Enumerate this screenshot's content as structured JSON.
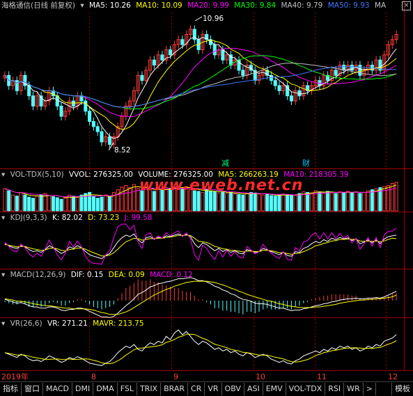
{
  "main_header": {
    "stock_name": "海格通信(日线 前复权)",
    "ma5_label": "MA5: 10.26",
    "ma10_label": "MA10: 10.09",
    "ma20_label": "MA20: 9.99",
    "ma30_label": "MA30: 9.84",
    "ma40_label": "MA40: 9.79",
    "ma50_label": "MA50: 9.93",
    "ma_more_label": "MA",
    "close_label": "×"
  },
  "price_annotations": {
    "high": "10.96",
    "low": "8.52"
  },
  "event_markers": {
    "reduce": "减",
    "fund": "财"
  },
  "vol_header": {
    "name": "VOL-TDX(5,10)",
    "vvol": "VVOL: 276325.00",
    "volume": "VOLUME: 276325.00",
    "ma5": "MA5: 266263.19",
    "ma10": "MA10: 218305.39"
  },
  "watermark": "www.eweb.net.cn",
  "kdj_header": {
    "name": "KDJ(9,3,3)",
    "k": "K: 82.02",
    "d": "D: 73.23",
    "j": "J: 99.58"
  },
  "macd_header": {
    "name": "MACD(12,26,9)",
    "dif": "DIF: 0.15",
    "dea": "DEA: 0.09",
    "macd": "MACD: 0.12"
  },
  "vr_header": {
    "name": "VR(26,6)",
    "vr": "VR: 271.21",
    "mavr": "MAVR: 213.75"
  },
  "date_axis": {
    "year": "2019年",
    "months": [
      "8",
      "9",
      "10",
      "11",
      "12"
    ]
  },
  "tabs": [
    "指标",
    "窗口",
    "MACD",
    "DMI",
    "DMA",
    "FSL",
    "TRIX",
    "BRAR",
    "CR",
    "VR",
    "OBV",
    "ASI",
    "EMV",
    "VOL-TDX",
    "RSI",
    "WR",
    ">"
  ],
  "template_tab": "模板",
  "colors": {
    "up": "#ff3c3c",
    "down": "#54ffff",
    "ma5": "#ffffff",
    "ma10": "#ffff00",
    "ma20": "#ff00ff",
    "ma30": "#00ff00",
    "ma40": "#c0c0c0",
    "ma50": "#3c78ff",
    "grid": "#a00000",
    "text": "#c0c0c0"
  },
  "chart_data": {
    "type": "candlestick",
    "ylim": [
      8.3,
      11.1
    ],
    "closes": [
      9.9,
      9.7,
      9.8,
      9.6,
      9.9,
      9.7,
      9.5,
      9.3,
      9.5,
      9.3,
      9.4,
      9.6,
      9.5,
      9.3,
      9.1,
      9.2,
      9.4,
      9.3,
      9.5,
      9.4,
      9.2,
      9.0,
      8.9,
      8.8,
      8.6,
      8.7,
      8.55,
      8.7,
      8.9,
      9.1,
      9.3,
      9.4,
      9.6,
      9.9,
      9.8,
      10.0,
      10.2,
      10.1,
      10.3,
      10.2,
      10.4,
      10.3,
      10.5,
      10.6,
      10.5,
      10.7,
      10.8,
      10.6,
      10.4,
      10.7,
      10.6,
      10.5,
      10.3,
      10.4,
      10.2,
      10.3,
      10.1,
      10.2,
      10.0,
      9.9,
      10.1,
      10.0,
      9.8,
      9.9,
      10.0,
      9.9,
      9.8,
      9.7,
      9.6,
      9.7,
      9.5,
      9.4,
      9.6,
      9.5,
      9.7,
      9.6,
      9.7,
      9.8,
      9.7,
      9.9,
      9.8,
      10.0,
      9.9,
      10.1,
      10.0,
      10.1,
      10.0,
      10.1,
      9.9,
      10.0,
      10.1,
      10.0,
      10.2,
      10.0,
      10.3,
      10.5,
      10.6,
      10.7
    ],
    "volume": [
      42,
      38,
      30,
      28,
      35,
      30,
      26,
      24,
      28,
      30,
      33,
      29,
      27,
      25,
      22,
      24,
      30,
      28,
      26,
      30,
      33,
      35,
      28,
      24,
      26,
      30,
      27,
      35,
      40,
      45,
      48,
      44,
      50,
      42,
      38,
      46,
      40,
      37,
      41,
      39,
      44,
      43,
      45,
      47,
      42,
      46,
      40,
      38,
      37,
      35,
      41,
      38,
      36,
      34,
      35,
      33,
      36,
      32,
      31,
      30,
      33,
      35,
      34,
      32,
      30,
      31,
      29,
      28,
      30,
      32,
      31,
      30,
      29,
      33,
      36,
      35,
      34,
      38,
      36,
      35,
      37,
      34,
      33,
      36,
      35,
      37,
      34,
      36,
      33,
      35,
      38,
      40,
      42,
      44,
      46,
      48,
      52,
      54
    ],
    "kdj_k": [
      60,
      55,
      50,
      48,
      55,
      52,
      45,
      40,
      42,
      38,
      45,
      55,
      50,
      42,
      35,
      40,
      52,
      48,
      55,
      50,
      40,
      32,
      28,
      25,
      22,
      30,
      35,
      50,
      65,
      75,
      82,
      78,
      85,
      70,
      62,
      75,
      78,
      72,
      76,
      74,
      80,
      78,
      82,
      85,
      80,
      84,
      78,
      60,
      50,
      62,
      58,
      50,
      42,
      48,
      40,
      45,
      38,
      42,
      36,
      34,
      45,
      42,
      38,
      40,
      48,
      44,
      40,
      36,
      32,
      38,
      30,
      28,
      40,
      38,
      48,
      52,
      60,
      66,
      62,
      70,
      66,
      74,
      70,
      76,
      72,
      75,
      68,
      72,
      60,
      64,
      70,
      62,
      70,
      60,
      72,
      78,
      80,
      82
    ],
    "kdj_d": [
      58,
      56,
      54,
      52,
      53,
      53,
      50,
      47,
      45,
      43,
      44,
      48,
      49,
      47,
      43,
      42,
      45,
      46,
      49,
      49,
      46,
      41,
      37,
      33,
      29,
      29,
      31,
      37,
      46,
      56,
      65,
      69,
      74,
      73,
      69,
      71,
      73,
      73,
      74,
      74,
      76,
      77,
      79,
      81,
      81,
      82,
      81,
      74,
      66,
      65,
      63,
      59,
      53,
      51,
      47,
      46,
      43,
      43,
      41,
      39,
      41,
      41,
      40,
      40,
      43,
      43,
      42,
      40,
      37,
      37,
      35,
      33,
      35,
      36,
      40,
      44,
      49,
      55,
      57,
      61,
      63,
      67,
      68,
      71,
      71,
      72,
      71,
      71,
      67,
      66,
      67,
      66,
      67,
      65,
      67,
      71,
      74,
      73
    ],
    "macd_dif": [
      0.02,
      0.0,
      -0.02,
      -0.04,
      -0.03,
      -0.05,
      -0.08,
      -0.1,
      -0.1,
      -0.12,
      -0.12,
      -0.1,
      -0.1,
      -0.12,
      -0.15,
      -0.16,
      -0.14,
      -0.14,
      -0.12,
      -0.12,
      -0.14,
      -0.17,
      -0.2,
      -0.23,
      -0.26,
      -0.26,
      -0.27,
      -0.25,
      -0.2,
      -0.14,
      -0.08,
      -0.03,
      0.03,
      0.1,
      0.13,
      0.17,
      0.22,
      0.24,
      0.27,
      0.28,
      0.3,
      0.31,
      0.33,
      0.35,
      0.35,
      0.36,
      0.37,
      0.35,
      0.32,
      0.32,
      0.3,
      0.27,
      0.23,
      0.21,
      0.17,
      0.15,
      0.11,
      0.09,
      0.05,
      0.02,
      0.01,
      -0.01,
      -0.04,
      -0.05,
      -0.05,
      -0.06,
      -0.08,
      -0.1,
      -0.12,
      -0.12,
      -0.14,
      -0.16,
      -0.15,
      -0.15,
      -0.13,
      -0.12,
      -0.1,
      -0.08,
      -0.07,
      -0.05,
      -0.04,
      -0.02,
      -0.01,
      0.01,
      0.02,
      0.03,
      0.03,
      0.04,
      0.03,
      0.03,
      0.04,
      0.04,
      0.05,
      0.04,
      0.06,
      0.09,
      0.12,
      0.15
    ],
    "macd_dea": [
      0.03,
      0.02,
      0.01,
      -0.01,
      -0.01,
      -0.02,
      -0.03,
      -0.05,
      -0.06,
      -0.07,
      -0.08,
      -0.08,
      -0.09,
      -0.1,
      -0.11,
      -0.12,
      -0.12,
      -0.13,
      -0.13,
      -0.13,
      -0.13,
      -0.14,
      -0.15,
      -0.17,
      -0.19,
      -0.2,
      -0.22,
      -0.22,
      -0.22,
      -0.2,
      -0.18,
      -0.15,
      -0.11,
      -0.07,
      -0.03,
      0.01,
      0.05,
      0.09,
      0.12,
      0.15,
      0.18,
      0.2,
      0.23,
      0.25,
      0.27,
      0.29,
      0.3,
      0.31,
      0.31,
      0.31,
      0.31,
      0.3,
      0.29,
      0.27,
      0.25,
      0.23,
      0.2,
      0.18,
      0.15,
      0.13,
      0.1,
      0.08,
      0.06,
      0.04,
      0.02,
      0.0,
      -0.01,
      -0.03,
      -0.05,
      -0.06,
      -0.08,
      -0.09,
      -0.1,
      -0.11,
      -0.11,
      -0.11,
      -0.11,
      -0.1,
      -0.1,
      -0.09,
      -0.08,
      -0.07,
      -0.06,
      -0.04,
      -0.03,
      -0.02,
      -0.01,
      0.0,
      0.01,
      0.01,
      0.02,
      0.02,
      0.03,
      0.03,
      0.04,
      0.05,
      0.06,
      0.09
    ],
    "vr": [
      160,
      150,
      140,
      130,
      150,
      140,
      120,
      110,
      115,
      105,
      120,
      140,
      130,
      115,
      100,
      110,
      130,
      120,
      135,
      125,
      110,
      95,
      90,
      85,
      80,
      95,
      105,
      130,
      160,
      180,
      200,
      190,
      210,
      180,
      170,
      200,
      220,
      210,
      230,
      220,
      260,
      240,
      280,
      300,
      270,
      290,
      260,
      230,
      210,
      230,
      220,
      200,
      180,
      190,
      170,
      180,
      160,
      170,
      150,
      140,
      160,
      150,
      130,
      140,
      150,
      140,
      120,
      110,
      100,
      110,
      95,
      90,
      110,
      120,
      140,
      150,
      160,
      170,
      160,
      180,
      170,
      190,
      180,
      200,
      190,
      200,
      180,
      190,
      170,
      180,
      200,
      190,
      210,
      200,
      230,
      240,
      250,
      271
    ]
  }
}
